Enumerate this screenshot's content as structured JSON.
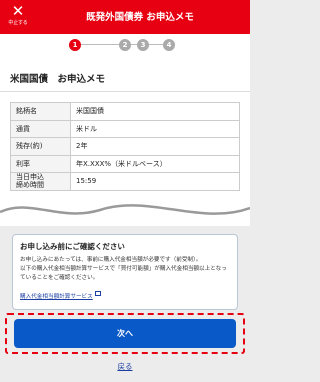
{
  "header": {
    "close_label": "中止する",
    "title": "既発外国債券 お申込メモ"
  },
  "steps": [
    "1",
    "2",
    "3",
    "4"
  ],
  "page": {
    "title": "米国国債　お申込メモ"
  },
  "table": {
    "rows": [
      {
        "label": "銘柄名",
        "value": "米国国債"
      },
      {
        "label": "通貨",
        "value": "米ドル"
      },
      {
        "label": "残存(約)",
        "value": "2年"
      },
      {
        "label": "利率",
        "value": "年X.XXX%（米ドルベース）"
      },
      {
        "label": "当日申込\n締め時間",
        "value": "15:59"
      }
    ]
  },
  "notice": {
    "title": "お申し込み前にご確認ください",
    "paragraph1": "お申し込みにあたっては、事前に購入代金相当額が必要です（前受制）。",
    "paragraph2": "以下の購入代金相当額計算サービスで「買付可能額」が購入代金相当額以上となっていることをご確認ください。",
    "link": "購入代金相当額計算サービス"
  },
  "buttons": {
    "next": "次へ",
    "back": "戻る"
  },
  "colors": {
    "brand_red": "#e60012",
    "primary_blue": "#0a59c9",
    "link_blue": "#1a3fa0"
  }
}
